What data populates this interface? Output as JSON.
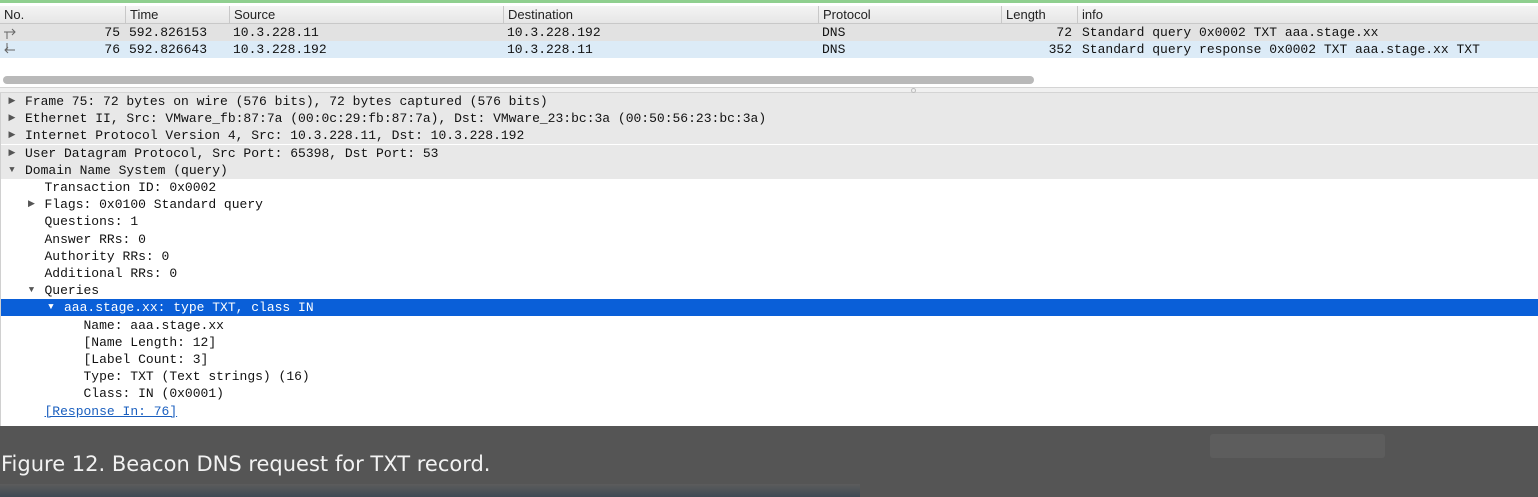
{
  "packet_list": {
    "columns": [
      "No.",
      "Time",
      "Source",
      "Destination",
      "Protocol",
      "Length",
      "info"
    ],
    "rows": [
      {
        "no": "75",
        "time": "592.826153",
        "source": "10.3.228.11",
        "destination": "10.3.228.192",
        "protocol": "DNS",
        "length": "72",
        "info": "Standard query 0x0002 TXT aaa.stage.xx"
      },
      {
        "no": "76",
        "time": "592.826643",
        "source": "10.3.228.192",
        "destination": "10.3.228.11",
        "protocol": "DNS",
        "length": "352",
        "info": "Standard query response 0x0002 TXT aaa.stage.xx TXT"
      }
    ]
  },
  "detail_tree": {
    "lines": [
      {
        "text": "Frame 75: 72 bytes on wire (576 bits), 72 bytes captured (576 bits)",
        "expander": "collapsed"
      },
      {
        "text": "Ethernet II, Src: VMware_fb:87:7a (00:0c:29:fb:87:7a), Dst: VMware_23:bc:3a (00:50:56:23:bc:3a)",
        "expander": "collapsed"
      },
      {
        "text": "Internet Protocol Version 4, Src: 10.3.228.11, Dst: 10.3.228.192",
        "expander": "collapsed"
      },
      {
        "text": "User Datagram Protocol, Src Port: 65398, Dst Port: 53",
        "expander": "collapsed"
      },
      {
        "text": "Domain Name System (query)",
        "expander": "expanded"
      },
      {
        "text": "Transaction ID: 0x0002",
        "expander": "none"
      },
      {
        "text": "Flags: 0x0100 Standard query",
        "expander": "collapsed"
      },
      {
        "text": "Questions: 1",
        "expander": "none"
      },
      {
        "text": "Answer RRs: 0",
        "expander": "none"
      },
      {
        "text": "Authority RRs: 0",
        "expander": "none"
      },
      {
        "text": "Additional RRs: 0",
        "expander": "none"
      },
      {
        "text": "Queries",
        "expander": "expanded"
      },
      {
        "text": "aaa.stage.xx: type TXT, class IN",
        "expander": "expanded",
        "selected": true
      },
      {
        "text": "Name: aaa.stage.xx",
        "expander": "none"
      },
      {
        "text": "[Name Length: 12]",
        "expander": "none"
      },
      {
        "text": "[Label Count: 3]",
        "expander": "none"
      },
      {
        "text": "Type: TXT (Text strings) (16)",
        "expander": "none"
      },
      {
        "text": "Class: IN (0x0001)",
        "expander": "none"
      },
      {
        "text": "[Response In: 76]",
        "expander": "none",
        "link": true
      }
    ]
  },
  "caption": {
    "text": "Figure 12. Beacon DNS request for TXT record."
  },
  "colors": {
    "selection": "#0a5fd8",
    "row_75": "#e2e2e2",
    "row_76": "#dcebf7",
    "caption_band": "#555555",
    "link": "#1a5fbf"
  }
}
